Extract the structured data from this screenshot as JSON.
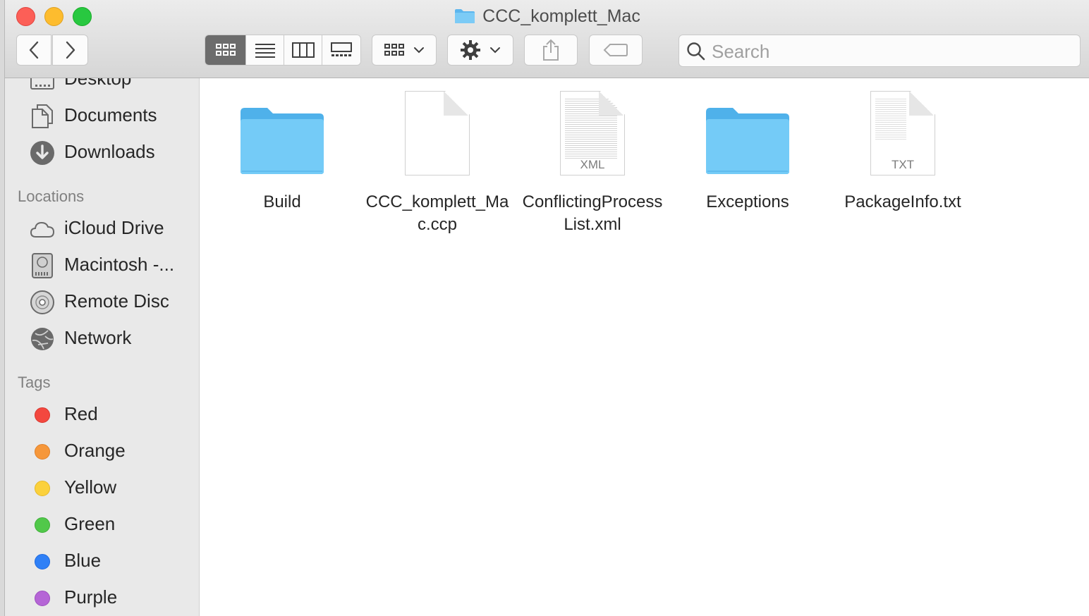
{
  "window": {
    "title": "CCC_komplett_Mac"
  },
  "toolbar": {
    "nav": [
      "back",
      "forward"
    ],
    "view_modes": [
      "icon-view",
      "list-view",
      "column-view",
      "gallery-view"
    ],
    "active_view": "icon-view",
    "search_placeholder": "Search"
  },
  "sidebar": {
    "top_items": [
      {
        "label": "Desktop",
        "icon": "desktop-icon"
      },
      {
        "label": "Documents",
        "icon": "documents-icon"
      },
      {
        "label": "Downloads",
        "icon": "downloads-icon"
      }
    ],
    "locations_header": "Locations",
    "locations": [
      {
        "label": "iCloud Drive",
        "icon": "cloud-icon"
      },
      {
        "label": "Macintosh -...",
        "icon": "hard-drive-icon"
      },
      {
        "label": "Remote Disc",
        "icon": "disc-icon"
      },
      {
        "label": "Network",
        "icon": "network-icon"
      }
    ],
    "tags_header": "Tags",
    "tags": [
      {
        "label": "Red",
        "color": "#f3483f"
      },
      {
        "label": "Orange",
        "color": "#f6973a"
      },
      {
        "label": "Yellow",
        "color": "#fbd13c"
      },
      {
        "label": "Green",
        "color": "#51c84a"
      },
      {
        "label": "Blue",
        "color": "#2f80f6"
      },
      {
        "label": "Purple",
        "color": "#b565d6"
      }
    ]
  },
  "files": [
    {
      "name": "Build",
      "kind": "folder"
    },
    {
      "name": "CCC_komplett_Mac.ccp",
      "kind": "blank-document"
    },
    {
      "name": "ConflictingProcessList.xml",
      "kind": "xml-document",
      "badge": "XML"
    },
    {
      "name": "Exceptions",
      "kind": "folder"
    },
    {
      "name": "PackageInfo.txt",
      "kind": "text-document",
      "badge": "TXT"
    }
  ],
  "colors": {
    "folder": "#6ec6f5",
    "folder_dark": "#4fb1ea",
    "accent": "#6c6c6c"
  }
}
